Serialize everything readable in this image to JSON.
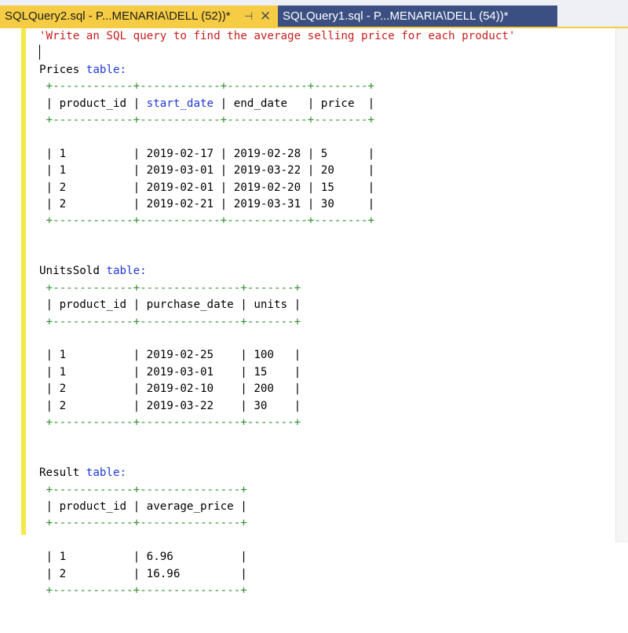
{
  "tabs": {
    "active": {
      "title": "SQLQuery2.sql - P...MENARIA\\DELL (52))*"
    },
    "inactive": {
      "title": "SQLQuery1.sql - P...MENARIA\\DELL (54))*"
    }
  },
  "editor": {
    "comment": "'Write an SQL query to find the average selling price for each product'",
    "prices": {
      "caption_name": "Prices",
      "caption_kw": "table:",
      "rule": "+------------+------------+------------+--------+",
      "header": [
        "product_id",
        "start_date",
        "end_date",
        "price"
      ],
      "rows": [
        [
          "1",
          "2019-02-17",
          "2019-02-28",
          "5"
        ],
        [
          "1",
          "2019-03-01",
          "2019-03-22",
          "20"
        ],
        [
          "2",
          "2019-02-01",
          "2019-02-20",
          "15"
        ],
        [
          "2",
          "2019-02-21",
          "2019-03-31",
          "30"
        ]
      ]
    },
    "units_sold": {
      "caption_name": "UnitsSold",
      "caption_kw": "table:",
      "rule": "+------------+---------------+-------+",
      "header": [
        "product_id",
        "purchase_date",
        "units"
      ],
      "rows": [
        [
          "1",
          "2019-02-25",
          "100"
        ],
        [
          "1",
          "2019-03-01",
          "15"
        ],
        [
          "2",
          "2019-02-10",
          "200"
        ],
        [
          "2",
          "2019-03-22",
          "30"
        ]
      ]
    },
    "result": {
      "caption_name": "Result",
      "caption_kw": "table:",
      "rule": "+------------+---------------+",
      "header": [
        "product_id",
        "average_price"
      ],
      "rows": [
        [
          "1",
          "6.96"
        ],
        [
          "2",
          "16.96"
        ]
      ]
    }
  },
  "colors": {
    "active_tab": "#f5cc44",
    "inactive_tab": "#3b4f82",
    "string": "#c81e1e",
    "keyword": "#1f38d8",
    "table_border": "#2f8f2f"
  }
}
